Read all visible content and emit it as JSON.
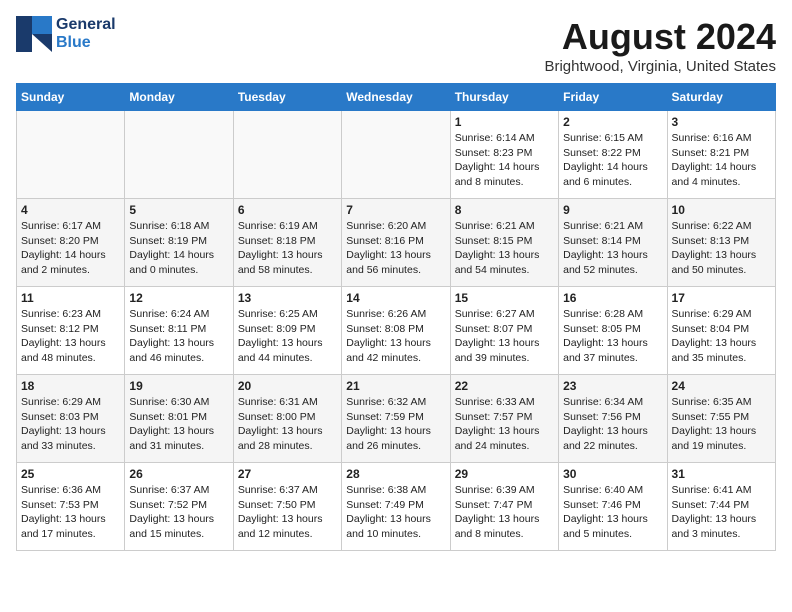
{
  "logo": {
    "line1": "General",
    "line2": "Blue"
  },
  "title": "August 2024",
  "subtitle": "Brightwood, Virginia, United States",
  "weekdays": [
    "Sunday",
    "Monday",
    "Tuesday",
    "Wednesday",
    "Thursday",
    "Friday",
    "Saturday"
  ],
  "weeks": [
    [
      {
        "day": "",
        "content": ""
      },
      {
        "day": "",
        "content": ""
      },
      {
        "day": "",
        "content": ""
      },
      {
        "day": "",
        "content": ""
      },
      {
        "day": "1",
        "content": "Sunrise: 6:14 AM\nSunset: 8:23 PM\nDaylight: 14 hours\nand 8 minutes."
      },
      {
        "day": "2",
        "content": "Sunrise: 6:15 AM\nSunset: 8:22 PM\nDaylight: 14 hours\nand 6 minutes."
      },
      {
        "day": "3",
        "content": "Sunrise: 6:16 AM\nSunset: 8:21 PM\nDaylight: 14 hours\nand 4 minutes."
      }
    ],
    [
      {
        "day": "4",
        "content": "Sunrise: 6:17 AM\nSunset: 8:20 PM\nDaylight: 14 hours\nand 2 minutes."
      },
      {
        "day": "5",
        "content": "Sunrise: 6:18 AM\nSunset: 8:19 PM\nDaylight: 14 hours\nand 0 minutes."
      },
      {
        "day": "6",
        "content": "Sunrise: 6:19 AM\nSunset: 8:18 PM\nDaylight: 13 hours\nand 58 minutes."
      },
      {
        "day": "7",
        "content": "Sunrise: 6:20 AM\nSunset: 8:16 PM\nDaylight: 13 hours\nand 56 minutes."
      },
      {
        "day": "8",
        "content": "Sunrise: 6:21 AM\nSunset: 8:15 PM\nDaylight: 13 hours\nand 54 minutes."
      },
      {
        "day": "9",
        "content": "Sunrise: 6:21 AM\nSunset: 8:14 PM\nDaylight: 13 hours\nand 52 minutes."
      },
      {
        "day": "10",
        "content": "Sunrise: 6:22 AM\nSunset: 8:13 PM\nDaylight: 13 hours\nand 50 minutes."
      }
    ],
    [
      {
        "day": "11",
        "content": "Sunrise: 6:23 AM\nSunset: 8:12 PM\nDaylight: 13 hours\nand 48 minutes."
      },
      {
        "day": "12",
        "content": "Sunrise: 6:24 AM\nSunset: 8:11 PM\nDaylight: 13 hours\nand 46 minutes."
      },
      {
        "day": "13",
        "content": "Sunrise: 6:25 AM\nSunset: 8:09 PM\nDaylight: 13 hours\nand 44 minutes."
      },
      {
        "day": "14",
        "content": "Sunrise: 6:26 AM\nSunset: 8:08 PM\nDaylight: 13 hours\nand 42 minutes."
      },
      {
        "day": "15",
        "content": "Sunrise: 6:27 AM\nSunset: 8:07 PM\nDaylight: 13 hours\nand 39 minutes."
      },
      {
        "day": "16",
        "content": "Sunrise: 6:28 AM\nSunset: 8:05 PM\nDaylight: 13 hours\nand 37 minutes."
      },
      {
        "day": "17",
        "content": "Sunrise: 6:29 AM\nSunset: 8:04 PM\nDaylight: 13 hours\nand 35 minutes."
      }
    ],
    [
      {
        "day": "18",
        "content": "Sunrise: 6:29 AM\nSunset: 8:03 PM\nDaylight: 13 hours\nand 33 minutes."
      },
      {
        "day": "19",
        "content": "Sunrise: 6:30 AM\nSunset: 8:01 PM\nDaylight: 13 hours\nand 31 minutes."
      },
      {
        "day": "20",
        "content": "Sunrise: 6:31 AM\nSunset: 8:00 PM\nDaylight: 13 hours\nand 28 minutes."
      },
      {
        "day": "21",
        "content": "Sunrise: 6:32 AM\nSunset: 7:59 PM\nDaylight: 13 hours\nand 26 minutes."
      },
      {
        "day": "22",
        "content": "Sunrise: 6:33 AM\nSunset: 7:57 PM\nDaylight: 13 hours\nand 24 minutes."
      },
      {
        "day": "23",
        "content": "Sunrise: 6:34 AM\nSunset: 7:56 PM\nDaylight: 13 hours\nand 22 minutes."
      },
      {
        "day": "24",
        "content": "Sunrise: 6:35 AM\nSunset: 7:55 PM\nDaylight: 13 hours\nand 19 minutes."
      }
    ],
    [
      {
        "day": "25",
        "content": "Sunrise: 6:36 AM\nSunset: 7:53 PM\nDaylight: 13 hours\nand 17 minutes."
      },
      {
        "day": "26",
        "content": "Sunrise: 6:37 AM\nSunset: 7:52 PM\nDaylight: 13 hours\nand 15 minutes."
      },
      {
        "day": "27",
        "content": "Sunrise: 6:37 AM\nSunset: 7:50 PM\nDaylight: 13 hours\nand 12 minutes."
      },
      {
        "day": "28",
        "content": "Sunrise: 6:38 AM\nSunset: 7:49 PM\nDaylight: 13 hours\nand 10 minutes."
      },
      {
        "day": "29",
        "content": "Sunrise: 6:39 AM\nSunset: 7:47 PM\nDaylight: 13 hours\nand 8 minutes."
      },
      {
        "day": "30",
        "content": "Sunrise: 6:40 AM\nSunset: 7:46 PM\nDaylight: 13 hours\nand 5 minutes."
      },
      {
        "day": "31",
        "content": "Sunrise: 6:41 AM\nSunset: 7:44 PM\nDaylight: 13 hours\nand 3 minutes."
      }
    ]
  ]
}
